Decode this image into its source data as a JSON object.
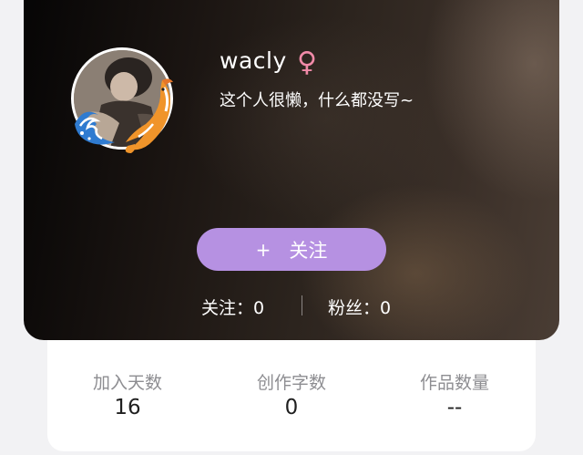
{
  "profile": {
    "username": "wacly",
    "gender_icon": "female-symbol-icon",
    "gender_glyph": "♀",
    "bio": "这个人很懒，什么都没写~",
    "avatar_icon": "avatar-icon",
    "accent_color": "#b691e2",
    "gender_color": "#f08aa8"
  },
  "follow_button": {
    "plus_glyph": "+",
    "label": "关注"
  },
  "social": {
    "following_label": "关注：",
    "following_count": "0",
    "fans_label": "粉丝：",
    "fans_count": "0"
  },
  "stats": [
    {
      "label": "加入天数",
      "value": "16"
    },
    {
      "label": "创作字数",
      "value": "0"
    },
    {
      "label": "作品数量",
      "value": "--"
    }
  ]
}
